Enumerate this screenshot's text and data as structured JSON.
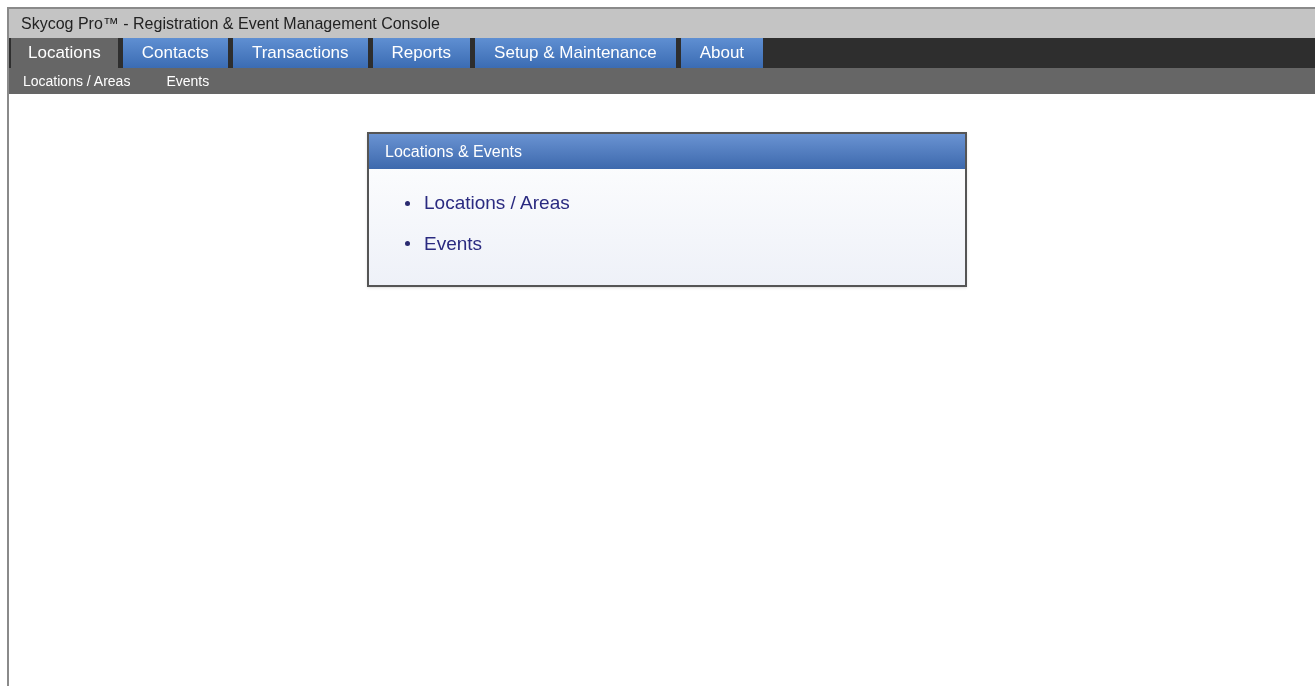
{
  "window": {
    "title": "Skycog Pro™ - Registration & Event Management Console"
  },
  "tabs": [
    {
      "label": "Locations",
      "selected": true
    },
    {
      "label": "Contacts",
      "selected": false
    },
    {
      "label": "Transactions",
      "selected": false
    },
    {
      "label": "Reports",
      "selected": false
    },
    {
      "label": "Setup & Maintenance",
      "selected": false
    },
    {
      "label": "About",
      "selected": false
    }
  ],
  "subnav": [
    "Locations / Areas",
    "Events"
  ],
  "panel": {
    "title": "Locations & Events",
    "links": [
      "Locations / Areas",
      "Events"
    ]
  }
}
